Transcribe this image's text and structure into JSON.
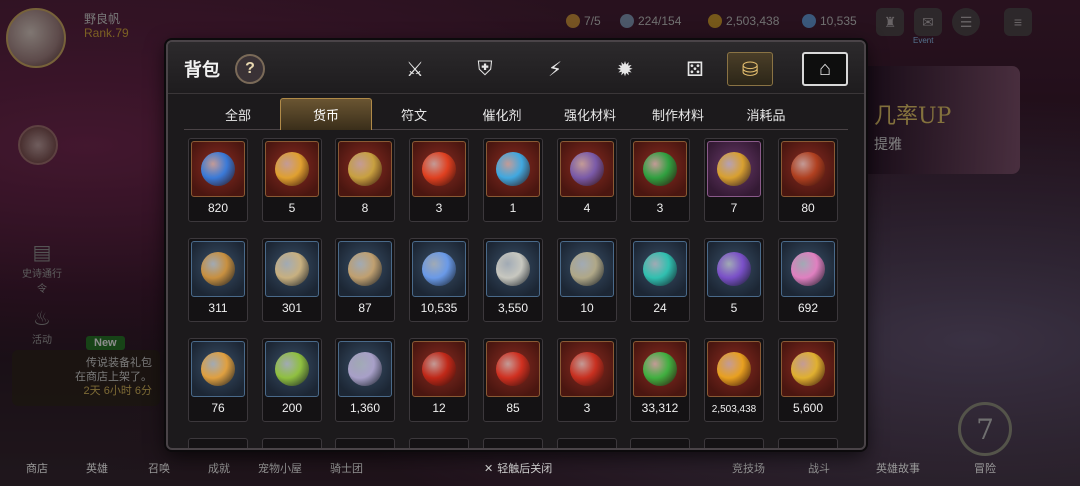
{
  "player": {
    "name": "野良帆",
    "rank": "Rank.79"
  },
  "resources": [
    {
      "icon": "stamina-icon",
      "value": "7/5",
      "color": "#d89a40"
    },
    {
      "icon": "energy-icon",
      "value": "224/154",
      "color": "#8aa0c0"
    },
    {
      "icon": "gold-coin-icon",
      "value": "2,503,438",
      "color": "#d8a030"
    },
    {
      "icon": "crystal-icon",
      "value": "10,535",
      "color": "#6aa0e0"
    }
  ],
  "hud": {
    "event_label": "Event"
  },
  "side": {
    "left_items": [
      "史诗通行令",
      "活动"
    ],
    "new_badge": "New",
    "promo_line1": "传说装备礼包",
    "promo_line2": "在商店上架了。",
    "promo_time": "2天 6小时 6分"
  },
  "banner": {
    "line1": "几率UP",
    "line2": "提雅"
  },
  "bottom_nav": [
    "商店",
    "英雄",
    "召唤",
    "成就",
    "宠物小屋",
    "骑士团",
    "竞技场",
    "战斗",
    "英雄故事",
    "冒险"
  ],
  "close_hint": "轻触后关闭",
  "rank_emblem": "7",
  "inventory": {
    "title": "背包",
    "help": "?",
    "category_tabs": [
      {
        "icon": "equipment-icon",
        "glyph": "⚔"
      },
      {
        "icon": "no-shield-icon",
        "glyph": "⛨"
      },
      {
        "icon": "lightning-icon",
        "glyph": "⚡"
      },
      {
        "icon": "burst-icon",
        "glyph": "✹"
      },
      {
        "icon": "dice-icon",
        "glyph": "⚄"
      },
      {
        "icon": "bag-icon",
        "glyph": "⛁"
      },
      {
        "icon": "chest-icon",
        "glyph": "⌂"
      }
    ],
    "active_category": 5,
    "sub_tabs": [
      "全部",
      "货币",
      "符文",
      "催化剂",
      "强化材料",
      "制作材料",
      "消耗品"
    ],
    "active_sub_tab": 1,
    "items": [
      {
        "icon": "eye-emblem-icon",
        "qty": "820",
        "frame": "red",
        "color": "#3a7ad8"
      },
      {
        "icon": "amber-crystal-icon",
        "qty": "5",
        "frame": "red",
        "color": "#e0a030"
      },
      {
        "icon": "beetle-icon",
        "qty": "8",
        "frame": "red",
        "color": "#c8a040"
      },
      {
        "icon": "fire-charm-icon",
        "qty": "3",
        "frame": "red",
        "color": "#e04020"
      },
      {
        "icon": "water-charm-icon",
        "qty": "1",
        "frame": "red",
        "color": "#40a8e0"
      },
      {
        "icon": "dark-charm-icon",
        "qty": "4",
        "frame": "red",
        "color": "#7a5aa8"
      },
      {
        "icon": "clover-charm-icon",
        "qty": "3",
        "frame": "red",
        "color": "#30a040"
      },
      {
        "icon": "gift-box-icon",
        "qty": "7",
        "frame": "purple",
        "color": "#d8a030"
      },
      {
        "icon": "crescent-charm-icon",
        "qty": "80",
        "frame": "red",
        "color": "#b04020"
      },
      {
        "icon": "medal-icon",
        "qty": "311",
        "frame": "blue",
        "color": "#c89040"
      },
      {
        "icon": "scroll-icon",
        "qty": "301",
        "frame": "blue",
        "color": "#c8b080"
      },
      {
        "icon": "compass-icon",
        "qty": "87",
        "frame": "blue",
        "color": "#c0a070"
      },
      {
        "icon": "blue-crystal-icon",
        "qty": "10,535",
        "frame": "blue",
        "color": "#6a9ae8"
      },
      {
        "icon": "silver-coin-icon",
        "qty": "3,550",
        "frame": "blue",
        "color": "#c8c8c0"
      },
      {
        "icon": "book-icon",
        "qty": "10",
        "frame": "blue",
        "color": "#b0a888"
      },
      {
        "icon": "teal-crystal-icon",
        "qty": "24",
        "frame": "blue",
        "color": "#30c0b0"
      },
      {
        "icon": "card-icon",
        "qty": "5",
        "frame": "blue",
        "color": "#7a50c8"
      },
      {
        "icon": "pink-crystal-cluster-icon",
        "qty": "692",
        "frame": "blue",
        "color": "#e080c0"
      },
      {
        "icon": "star-amulet-icon",
        "qty": "76",
        "frame": "blue",
        "color": "#e0a040"
      },
      {
        "icon": "green-card-icon",
        "qty": "200",
        "frame": "blue",
        "color": "#90c040"
      },
      {
        "icon": "star-shield-icon",
        "qty": "1,360",
        "frame": "blue",
        "color": "#a8a0c8"
      },
      {
        "icon": "red-orb-icon",
        "qty": "12",
        "frame": "red",
        "color": "#c02818"
      },
      {
        "icon": "red-bracelet-icon",
        "qty": "85",
        "frame": "red",
        "color": "#d03020"
      },
      {
        "icon": "red-badge-icon",
        "qty": "3",
        "frame": "red",
        "color": "#c83020"
      },
      {
        "icon": "green-heart-icon",
        "qty": "33,312",
        "frame": "red",
        "color": "#40b040"
      },
      {
        "icon": "gold-coin-icon",
        "qty": "2,503,438",
        "frame": "red",
        "color": "#e8a020"
      },
      {
        "icon": "gold-gem-icon",
        "qty": "5,600",
        "frame": "red",
        "color": "#e0b030"
      }
    ]
  }
}
